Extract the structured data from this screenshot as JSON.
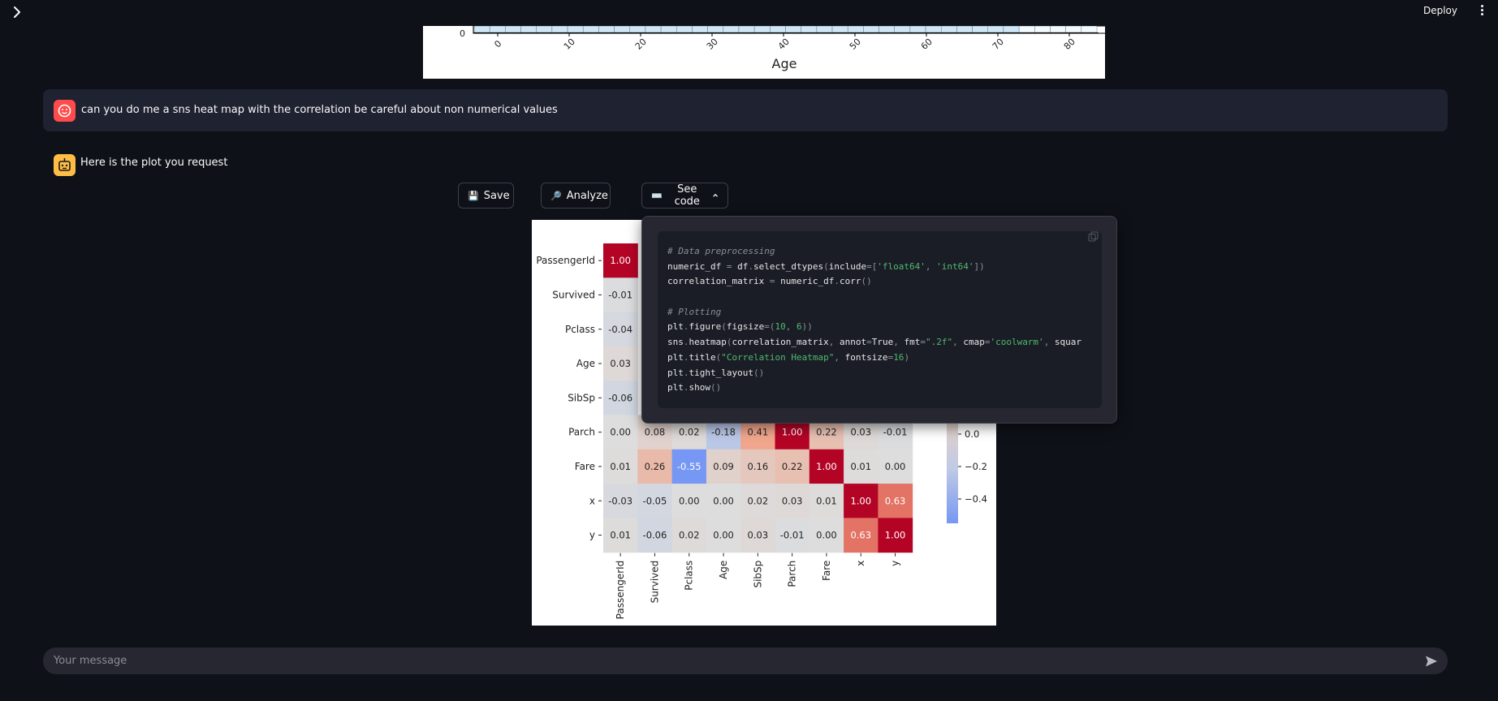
{
  "topbar": {
    "deploy_label": "Deploy"
  },
  "histogram": {
    "y_tick": "0",
    "x_ticks": [
      "0",
      "10",
      "20",
      "30",
      "40",
      "50",
      "60",
      "70",
      "80"
    ],
    "xlabel": "Age"
  },
  "messages": {
    "user_text": "can you do me a sns heat map with the correlation be careful about non numerical values",
    "bot_text": "Here is the plot you request"
  },
  "buttons": {
    "save_label": "Save",
    "analyze_label": "Analyze",
    "code_label": "See code",
    "save_icon": "floppy-disk-icon",
    "analyze_icon": "magnifier-icon",
    "code_icon": "keyboard-icon"
  },
  "code": {
    "lines": [
      "# Data preprocessing",
      "numeric_df = df.select_dtypes(include=['float64', 'int64'])",
      "correlation_matrix = numeric_df.corr()",
      "",
      "# Plotting",
      "plt.figure(figsize=(10, 6))",
      "sns.heatmap(correlation_matrix, annot=True, fmt=\".2f\", cmap='coolwarm', squar",
      "plt.title(\"Correlation Heatmap\", fontsize=16)",
      "plt.tight_layout()",
      "plt.show()"
    ]
  },
  "chart_data": {
    "type": "heatmap",
    "labels": [
      "PassengerId",
      "Survived",
      "Pclass",
      "Age",
      "SibSp",
      "Parch",
      "Fare",
      "x",
      "y"
    ],
    "visible_rows": [
      {
        "row": "PassengerId",
        "values": [
          1.0
        ]
      },
      {
        "row": "Survived",
        "values": [
          -0.01
        ]
      },
      {
        "row": "Pclass",
        "values": [
          -0.04
        ]
      },
      {
        "row": "Age",
        "values": [
          0.03
        ]
      },
      {
        "row": "SibSp",
        "values": [
          -0.06
        ]
      },
      {
        "row": "Parch",
        "values": [
          -0.0,
          0.08,
          0.02,
          -0.18,
          0.41,
          1.0,
          0.22,
          0.03,
          -0.01
        ]
      },
      {
        "row": "Fare",
        "values": [
          0.01,
          0.26,
          -0.55,
          0.09,
          0.16,
          0.22,
          1.0,
          0.01,
          -0.0
        ]
      },
      {
        "row": "x",
        "values": [
          -0.03,
          -0.05,
          0.0,
          -0.0,
          0.02,
          0.03,
          0.01,
          1.0,
          0.63
        ]
      },
      {
        "row": "y",
        "values": [
          0.01,
          -0.06,
          0.02,
          -0.0,
          0.03,
          -0.01,
          -0.0,
          0.63,
          1.0
        ]
      }
    ],
    "colorbar_ticks": [
      "0.0",
      "−0.2",
      "−0.4"
    ],
    "colormap": "coolwarm"
  },
  "chat_input": {
    "placeholder": "Your message"
  },
  "colors": {
    "background": "#0e1117",
    "user_avatar": "#ff4b4b",
    "bot_avatar": "#ffbd45"
  }
}
